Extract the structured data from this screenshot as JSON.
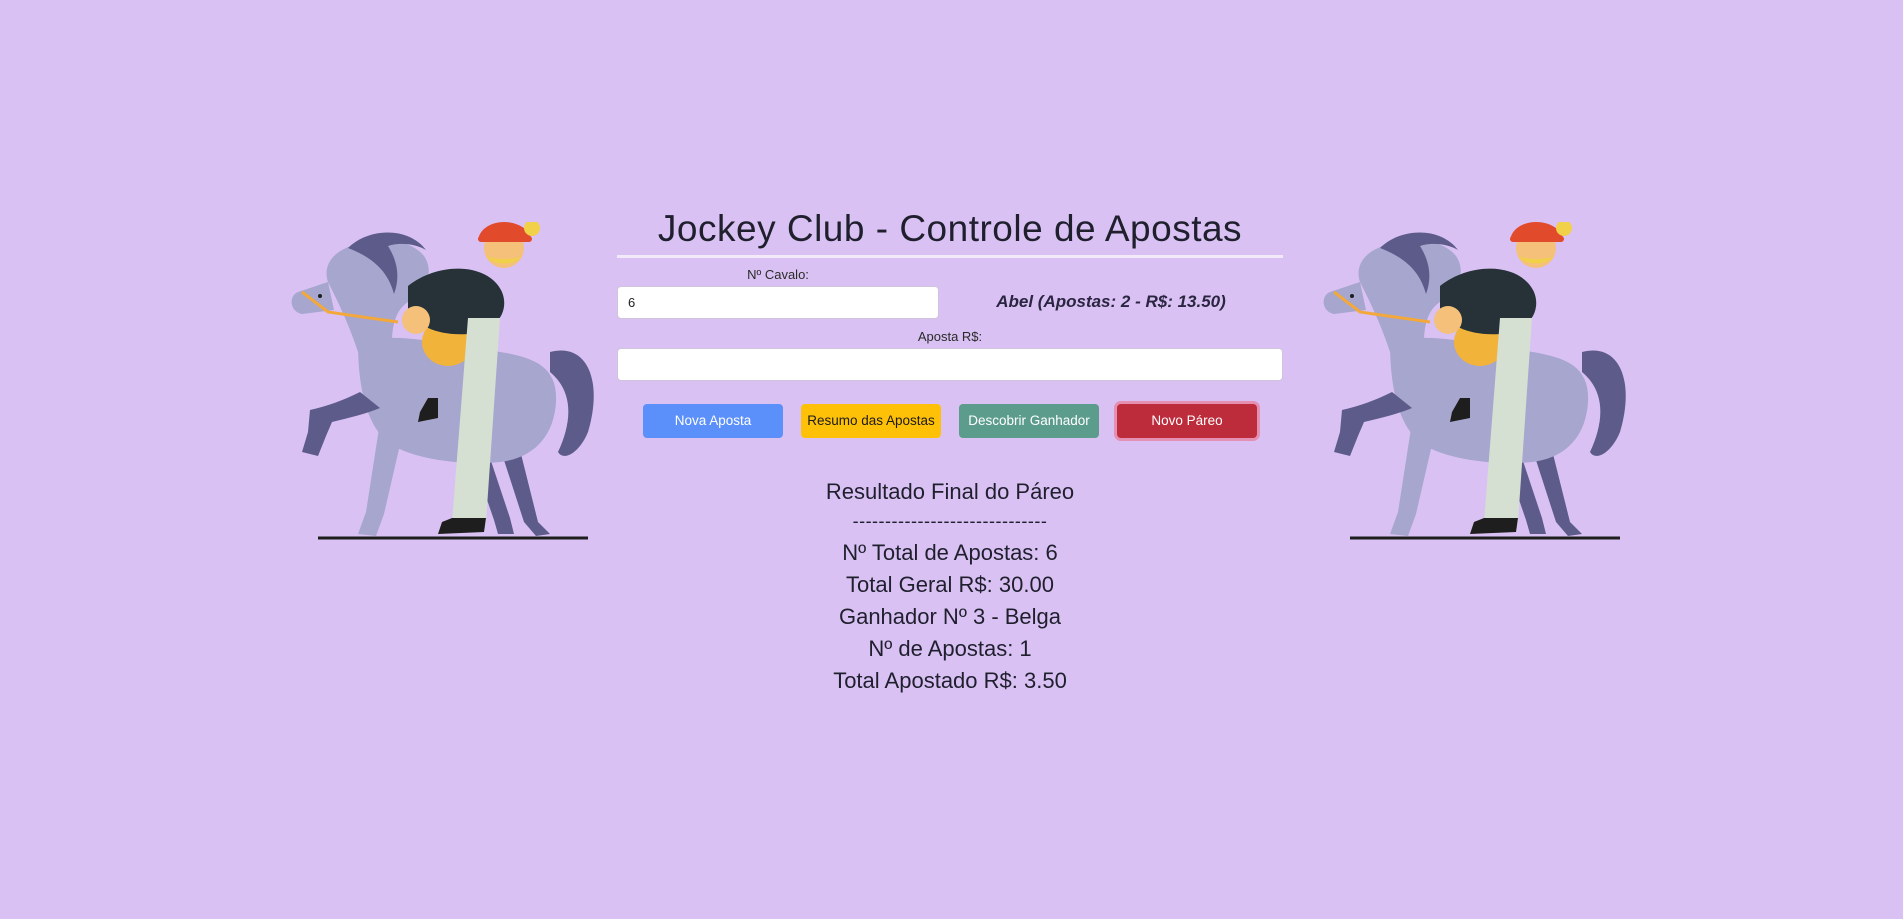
{
  "app": {
    "title": "Jockey Club - Controle de Apostas"
  },
  "form": {
    "horse_label": "Nº Cavalo:",
    "horse_value": "6",
    "bet_label": "Aposta R$:",
    "bet_value": ""
  },
  "bettor_summary": "Abel (Apostas: 2 - R$: 13.50)",
  "buttons": {
    "new_bet": "Nova Aposta",
    "summary": "Resumo das Apostas",
    "winner": "Descobrir Ganhador",
    "new_race": "Novo Páreo"
  },
  "results": {
    "title": "Resultado Final do Páreo",
    "divider": "------------------------------",
    "total_bets": "Nº Total de Apostas: 6",
    "total_amount": "Total Geral R$: 30.00",
    "winner": "Ganhador Nº 3 - Belga",
    "winner_bets": "Nº de Apostas: 1",
    "winner_amount": "Total Apostado R$: 3.50"
  },
  "colors": {
    "background": "#d9c2f3",
    "btn_new_bet": "#5b8ff9",
    "btn_summary": "#ffc107",
    "btn_winner": "#5c9c8d",
    "btn_new_race": "#bd2c3b"
  },
  "icons": {
    "illustration": "horse-jockey-illustration"
  }
}
